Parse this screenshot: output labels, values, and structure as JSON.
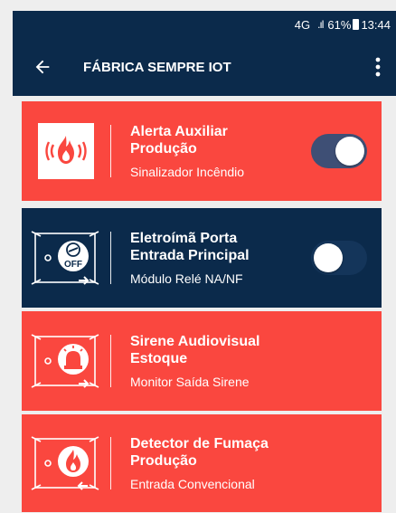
{
  "status_bar": {
    "network": "4G",
    "battery": "61%",
    "time": "13:44"
  },
  "app_bar": {
    "title": "FÁBRICA SEMPRE IOT",
    "back_icon": "arrow-back-icon",
    "menu_icon": "more-vert-icon"
  },
  "colors": {
    "primary": "#0b2a4b",
    "alert": "#fa473f",
    "toggle_on": "#3e4f75"
  },
  "devices": [
    {
      "title_line1": "Alerta Auxiliar",
      "title_line2": "Produção",
      "subtitle": "Sinalizador Incêndio",
      "icon": "fire-alarm-icon",
      "color": "red",
      "toggle": "on"
    },
    {
      "title_line1": "Eletroímã Porta",
      "title_line2": "Entrada Principal",
      "subtitle": "Módulo Relé NA/NF",
      "icon": "relay-module-off-icon",
      "color": "navy",
      "toggle": "off"
    },
    {
      "title_line1": "Sirene Audiovisual",
      "title_line2": "Estoque",
      "subtitle": "Monitor Saída Sirene",
      "icon": "siren-monitor-icon",
      "color": "red"
    },
    {
      "title_line1": "Detector de Fumaça",
      "title_line2": "Produção",
      "subtitle": "Entrada Convencional",
      "icon": "smoke-detector-input-icon",
      "color": "red"
    }
  ]
}
